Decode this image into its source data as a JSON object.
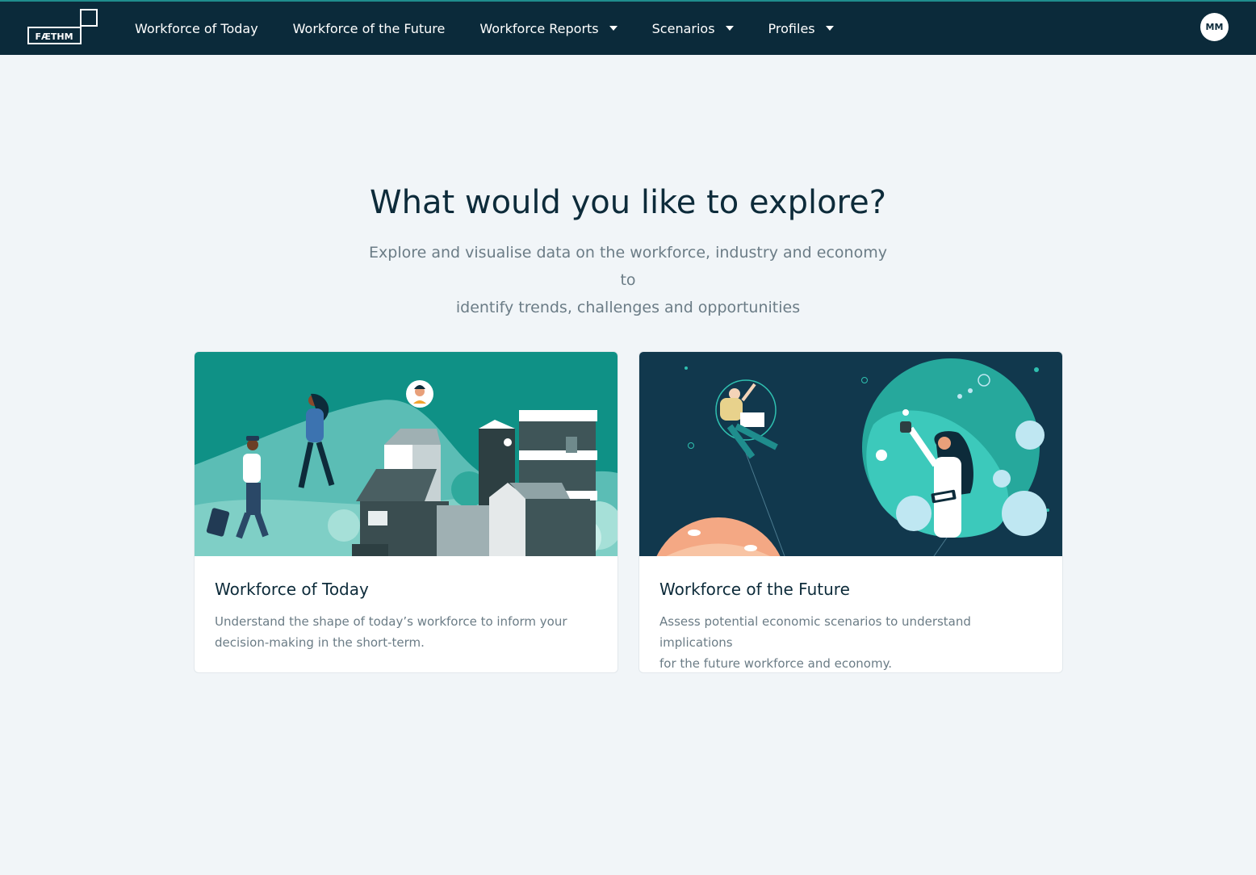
{
  "app": {
    "logo_text": "FÆTHM",
    "user_initials": "MM"
  },
  "nav": {
    "items": [
      {
        "label": "Workforce of Today",
        "dropdown": false
      },
      {
        "label": "Workforce of the Future",
        "dropdown": false
      },
      {
        "label": "Workforce Reports",
        "dropdown": true
      },
      {
        "label": "Scenarios",
        "dropdown": true
      },
      {
        "label": "Profiles",
        "dropdown": true
      }
    ]
  },
  "hero": {
    "title": "What would you like to explore?",
    "subtitle_line1": "Explore and visualise data on the workforce, industry and economy to",
    "subtitle_line2": "identify trends, challenges and opportunities"
  },
  "cards": [
    {
      "title": "Workforce of Today",
      "desc_line1": "Understand the shape of today’s workforce to inform your",
      "desc_line2": "decision-making in the short-term.",
      "illustration": "city-commuters-illustration"
    },
    {
      "title": "Workforce of the Future",
      "desc_line1": "Assess potential economic scenarios to understand implications",
      "desc_line2": "for the future workforce and economy.",
      "illustration": "space-scientist-illustration"
    }
  ],
  "colors": {
    "nav_bg": "#0b2a3a",
    "page_bg": "#f1f5f8",
    "teal": "#0f9186",
    "dark_navy": "#11384d"
  }
}
